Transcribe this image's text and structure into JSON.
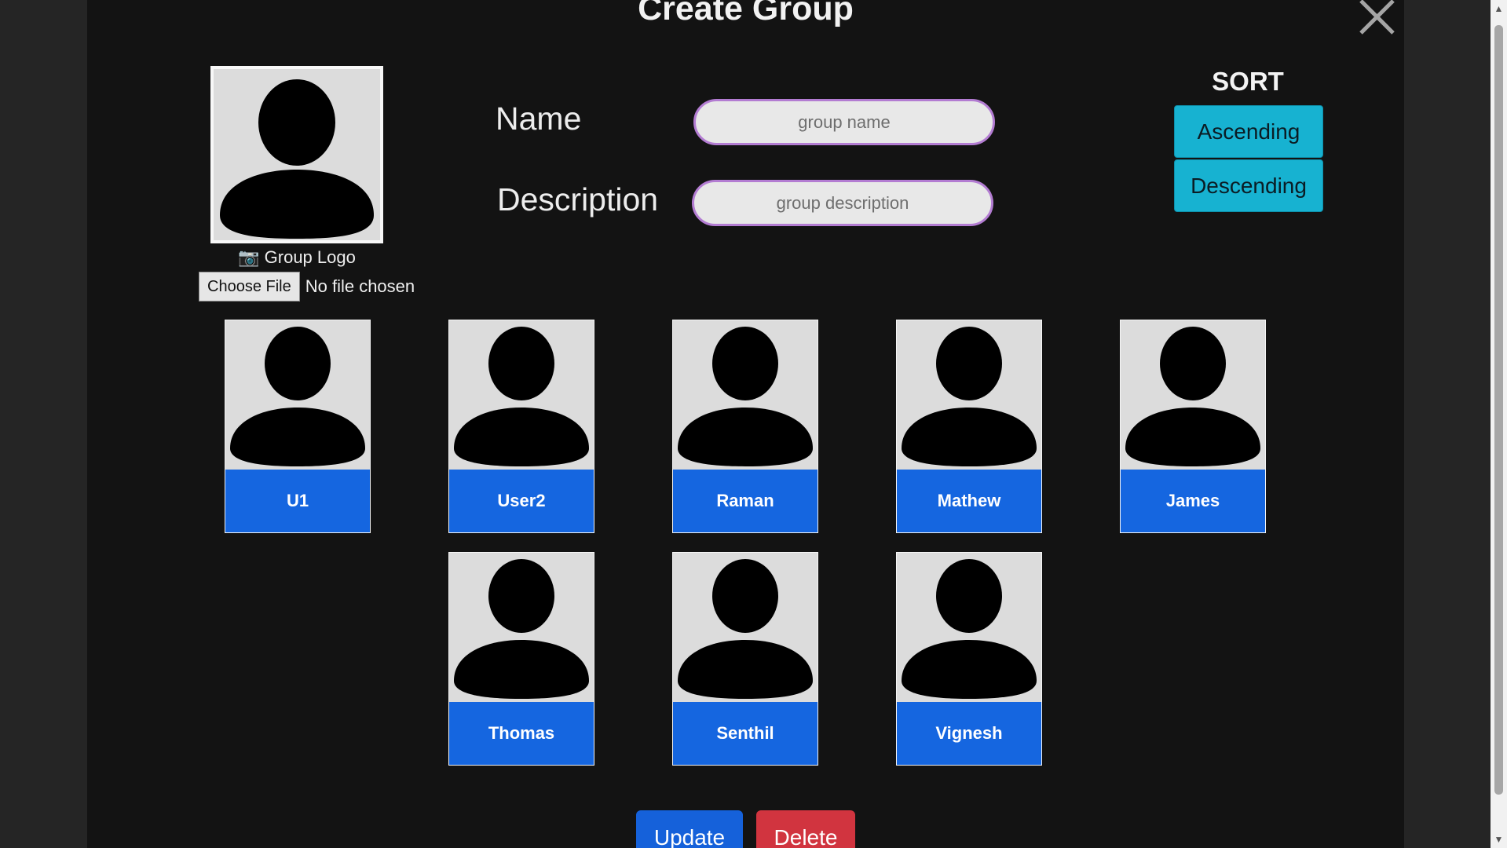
{
  "modal": {
    "title": "Create Group"
  },
  "logo": {
    "caption": "📷 Group Logo",
    "choose_file_label": "Choose File",
    "file_status": "No file chosen"
  },
  "form": {
    "name_label": "Name",
    "name_placeholder": "group name",
    "description_label": "Description",
    "description_placeholder": "group description"
  },
  "sort": {
    "title": "SORT",
    "ascending_label": "Ascending",
    "descending_label": "Descending"
  },
  "members": [
    "U1",
    "User2",
    "Raman",
    "Mathew",
    "James",
    "Thomas",
    "Senthil",
    "Vignesh"
  ],
  "actions": {
    "update_label": "Update",
    "delete_label": "Delete"
  },
  "icons": {
    "close": "close-icon",
    "avatar": "person-silhouette-icon",
    "camera": "camera-icon"
  },
  "colors": {
    "background": "#131313",
    "member_card": "#1566e0",
    "sort_button": "#17b2d1",
    "update_button": "#1561da",
    "delete_button": "#d1343f",
    "input_border": "#b37cd2"
  }
}
